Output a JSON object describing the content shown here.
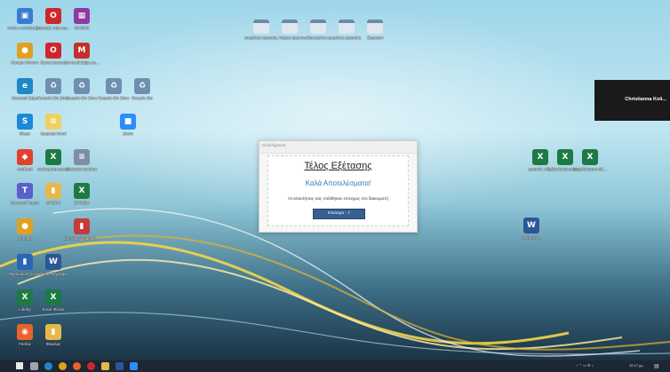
{
  "desktop_icons": [
    {
      "label": "Αυτός ο υπολογιστής",
      "glyph": "▣",
      "color": "#3a7bd5",
      "icon": "this-pc-icon"
    },
    {
      "label": "Επιλογές στην πρόσβαση",
      "glyph": "O",
      "color": "#d0262a",
      "icon": "opera-icon"
    },
    {
      "label": "WinRAR",
      "glyph": "▦",
      "color": "#8e3aa3",
      "icon": "winrar-icon"
    },
    {
      "label": "Google Chrome",
      "glyph": "●",
      "color": "#e0a020",
      "icon": "chrome-icon"
    },
    {
      "label": "Opera Browser",
      "glyph": "O",
      "color": "#d0262a",
      "icon": "opera-icon"
    },
    {
      "label": "Microsoft Edge and Desktop",
      "glyph": "M",
      "color": "#c4302b",
      "icon": "mcafee-icon"
    },
    {
      "label": "Microsoft Edge",
      "glyph": "e",
      "color": "#1e88c8",
      "icon": "edge-icon"
    },
    {
      "label": "Recycle Bin Drive",
      "glyph": "♻",
      "color": "#6f8fb0",
      "icon": "recycle-icon"
    },
    {
      "label": "Recycle Bin Drive",
      "glyph": "♻",
      "color": "#6f8fb0",
      "icon": "recycle-icon"
    },
    {
      "label": "Recycle Bin Drive",
      "glyph": "♻",
      "color": "#6f8fb0",
      "icon": "recycle-icon"
    },
    {
      "label": "Recycle Bin",
      "glyph": "♻",
      "color": "#6f8fb0",
      "icon": "recycle-icon"
    },
    {
      "label": "Skype",
      "glyph": "S",
      "color": "#1a8ad8",
      "icon": "skype-icon"
    },
    {
      "label": "έγγραφο Word",
      "glyph": "≡",
      "color": "#f0d060",
      "icon": "file-icon"
    },
    {
      "label": "Zoom",
      "glyph": "■",
      "color": "#2d8cff",
      "icon": "zoom-icon"
    },
    {
      "label": "AnyDesk",
      "glyph": "◆",
      "color": "#e0412e",
      "icon": "anydesk-icon"
    },
    {
      "label": "επιλεγμένη μορφή",
      "glyph": "X",
      "color": "#1d7a45",
      "icon": "excel-icon"
    },
    {
      "label": "έγγραφο κειμένου",
      "glyph": "≡",
      "color": "#7d8fa8",
      "icon": "notepad-icon"
    },
    {
      "label": "Microsoft Teams",
      "glyph": "T",
      "color": "#5b5fc7",
      "icon": "teams-icon"
    },
    {
      "label": "ΑΡΧΕΙΟ",
      "glyph": "▮",
      "color": "#e6b84b",
      "icon": "folder-icon"
    },
    {
      "label": "ΕΡΓΑΣΙΑ",
      "glyph": "X",
      "color": "#1d7a45",
      "icon": "excel-icon"
    },
    {
      "label": "Chrome",
      "glyph": "●",
      "color": "#e0a020",
      "icon": "chrome-icon"
    },
    {
      "label": "Συντόμευση αρχείων",
      "glyph": "▮",
      "color": "#c43b3b",
      "icon": "shortcut-icon"
    },
    {
      "label": "Παρουσίαση Κύρια",
      "glyph": "▮",
      "color": "#2a65b8",
      "icon": "document-icon"
    },
    {
      "label": "Word Έγγραφο",
      "glyph": "W",
      "color": "#2b5797",
      "icon": "word-icon"
    },
    {
      "label": "Library",
      "glyph": "X",
      "color": "#1d7a45",
      "icon": "excel-icon"
    },
    {
      "label": "Excel Φύλλο",
      "glyph": "X",
      "color": "#1d7a45",
      "icon": "excel-icon"
    },
    {
      "label": "Firefox",
      "glyph": "◉",
      "color": "#e8622a",
      "icon": "firefox-icon"
    },
    {
      "label": "Φάκελος",
      "glyph": "▮",
      "color": "#e6b84b",
      "icon": "folder-icon"
    }
  ],
  "top_icons": [
    {
      "label": "επιφάνεια εργασίας",
      "icon": "folder-icon"
    },
    {
      "label": "λήψεις έργα",
      "icon": "folder-icon"
    },
    {
      "label": "αποθηκευμένα αρχεία",
      "icon": "folder-icon"
    },
    {
      "label": "εικόνες εργασίας",
      "icon": "folder-icon"
    },
    {
      "label": "Έγγραφα",
      "icon": "folder-icon"
    }
  ],
  "right_icons": [
    {
      "label": "εργασία_πλ...",
      "glyph": "X",
      "color": "#1d7a45",
      "icon": "excel-icon"
    },
    {
      "label": "βαθμολογία φοιτητών...",
      "glyph": "X",
      "color": "#1d7a45",
      "icon": "excel-icon"
    },
    {
      "label": "αποτελέσματα εξέτασης...",
      "glyph": "X",
      "color": "#1d7a45",
      "icon": "excel-icon"
    },
    {
      "label": "word έγγρ.",
      "glyph": "W",
      "color": "#2b5797",
      "icon": "word-icon"
    }
  ],
  "dialog": {
    "header": "Ολοκλήρωση",
    "title": "Τέλος Εξέτασης",
    "subtitle": "Καλά Αποτελέσματα!",
    "message": "Οι απαντήσεις σας στάλθηκαν επιτυχώς στο διακομιστή",
    "button_label": "Κλείσιμο - 7"
  },
  "notification": {
    "name": "Christianna Koli..."
  },
  "taskbar": {
    "items": [
      {
        "icon": "windows-start-icon",
        "color": "#e8e8e8"
      },
      {
        "icon": "search-icon",
        "color": "#9aa6b4"
      },
      {
        "icon": "edge-icon",
        "color": "#1e88c8"
      },
      {
        "icon": "chrome-icon",
        "color": "#e0a020"
      },
      {
        "icon": "firefox-icon",
        "color": "#e8622a"
      },
      {
        "icon": "opera-icon",
        "color": "#d0262a"
      },
      {
        "icon": "file-explorer-icon",
        "color": "#e6b84b"
      },
      {
        "icon": "word-icon",
        "color": "#2b5797"
      },
      {
        "icon": "zoom-icon",
        "color": "#2d8cff"
      }
    ],
    "clock": "10:17 μμ"
  }
}
